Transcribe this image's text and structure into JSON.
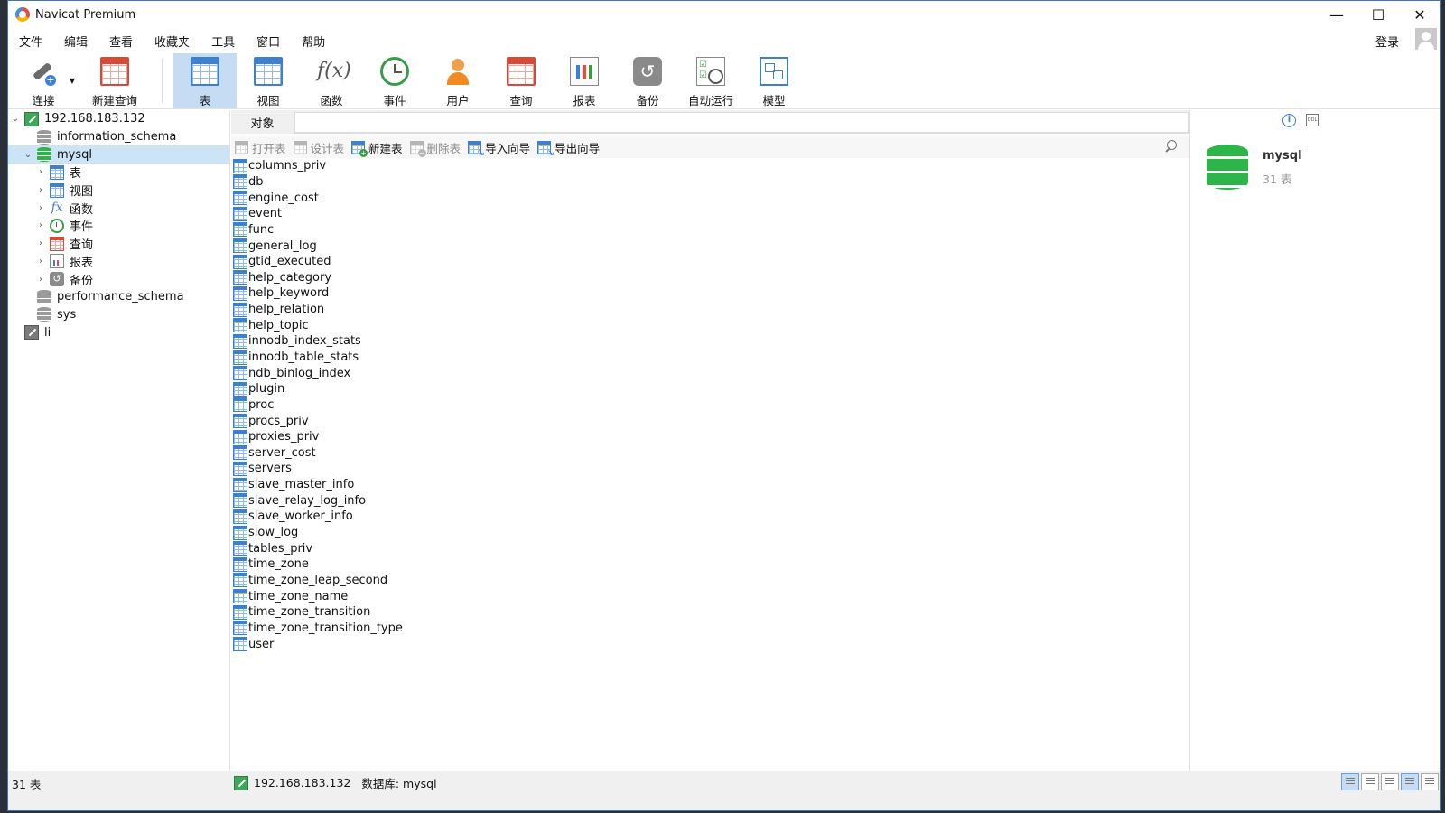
{
  "window": {
    "title": "Navicat Premium",
    "controls": [
      "—",
      "☐",
      "✕"
    ]
  },
  "menu": {
    "items": [
      "文件",
      "编辑",
      "查看",
      "收藏夹",
      "工具",
      "窗口",
      "帮助"
    ],
    "login": "登录"
  },
  "toolbar": {
    "connect": "连接",
    "new_query": "新建查询",
    "table": "表",
    "view": "视图",
    "function": "函数",
    "event": "事件",
    "user": "用户",
    "query": "查询",
    "report": "报表",
    "backup": "备份",
    "automation": "自动运行",
    "model": "模型"
  },
  "tree": {
    "connection": "192.168.183.132",
    "db_information_schema": "information_schema",
    "db_mysql": "mysql",
    "children": [
      "表",
      "视图",
      "函数",
      "事件",
      "查询",
      "报表",
      "备份"
    ],
    "db_performance_schema": "performance_schema",
    "db_sys": "sys",
    "connection2": "li"
  },
  "center": {
    "tab": "对象",
    "actions": {
      "open_table": "打开表",
      "design_table": "设计表",
      "new_table": "新建表",
      "delete_table": "删除表",
      "import_wizard": "导入向导",
      "export_wizard": "导出向导"
    },
    "tables": [
      "columns_priv",
      "db",
      "engine_cost",
      "event",
      "func",
      "general_log",
      "gtid_executed",
      "help_category",
      "help_keyword",
      "help_relation",
      "help_topic",
      "innodb_index_stats",
      "innodb_table_stats",
      "ndb_binlog_index",
      "plugin",
      "proc",
      "procs_priv",
      "proxies_priv",
      "server_cost",
      "servers",
      "slave_master_info",
      "slave_relay_log_info",
      "slave_worker_info",
      "slow_log",
      "tables_priv",
      "time_zone",
      "time_zone_leap_second",
      "time_zone_name",
      "time_zone_transition",
      "time_zone_transition_type",
      "user"
    ]
  },
  "right": {
    "db_name": "mysql",
    "table_count": "31 表",
    "info_glyph": "i",
    "ddl_glyph": "DDL"
  },
  "status": {
    "count": "31 表",
    "connection": "192.168.183.132",
    "database": "数据库: mysql"
  }
}
